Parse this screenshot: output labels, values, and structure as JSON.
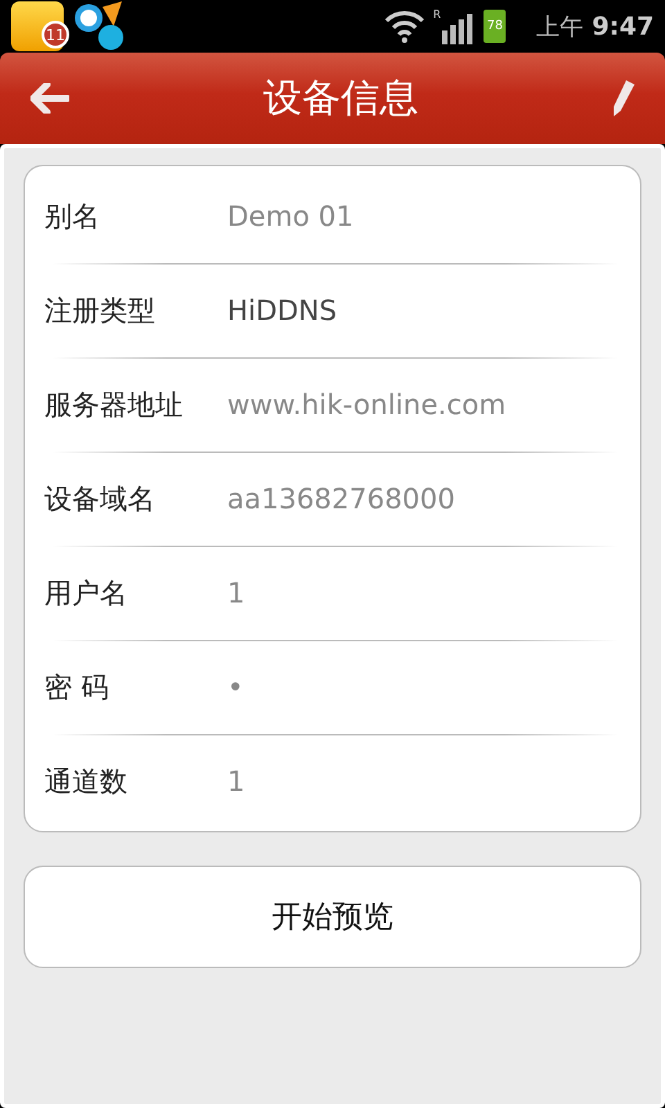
{
  "status_bar": {
    "notification_badge": "11",
    "signal_label": "R",
    "battery": "78",
    "time_period": "上午",
    "time": "9:47"
  },
  "header": {
    "title": "设备信息"
  },
  "fields": [
    {
      "label": "别名",
      "value": "Demo 01",
      "kind": "text"
    },
    {
      "label": "注册类型",
      "value": "HiDDNS",
      "kind": "select"
    },
    {
      "label": "服务器地址",
      "value": "www.hik-online.com",
      "kind": "text"
    },
    {
      "label": "设备域名",
      "value": "aa13682768000",
      "kind": "text"
    },
    {
      "label": "用户名",
      "value": "1",
      "kind": "text"
    },
    {
      "label": "密 码",
      "value": "•",
      "kind": "text"
    },
    {
      "label": "通道数",
      "value": "1",
      "kind": "text"
    }
  ],
  "buttons": [
    "开始预览"
  ]
}
